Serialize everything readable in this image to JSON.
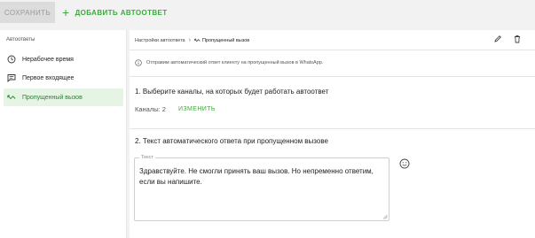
{
  "toolbar": {
    "save_label": "СОХРАНИТЬ",
    "add_label": "ДОБАВИТЬ АВТООТВЕТ"
  },
  "sidebar": {
    "heading": "Автоответы",
    "items": [
      {
        "label": "Нерабочее время",
        "icon": "clock-icon",
        "active": false
      },
      {
        "label": "Первое входящее",
        "icon": "message-icon",
        "active": false
      },
      {
        "label": "Пропущенный вызов",
        "icon": "missed-call-icon",
        "active": true
      }
    ]
  },
  "main": {
    "breadcrumb": {
      "parent": "Настройки автоответа",
      "current": "Пропущенный вызов"
    },
    "info_text": "Отправим автоматический ответ клиенту на пропущенный вызов в WhatsApp.",
    "section1_title": "1. Выберите каналы, на которых будет работать автоответ",
    "channels_text": "Каналы: 2",
    "change_label": "ИЗМЕНИТЬ",
    "section2_title": "2. Текст автоматического ответа при пропущенном вызове",
    "text_field": {
      "label": "Текст",
      "value": "Здравствуйте. Не смогли принять ваш вызов. Но непременно ответим, если вы напишите."
    }
  },
  "colors": {
    "accent": "#3daa3d",
    "active_bg": "#e6f4e6"
  }
}
